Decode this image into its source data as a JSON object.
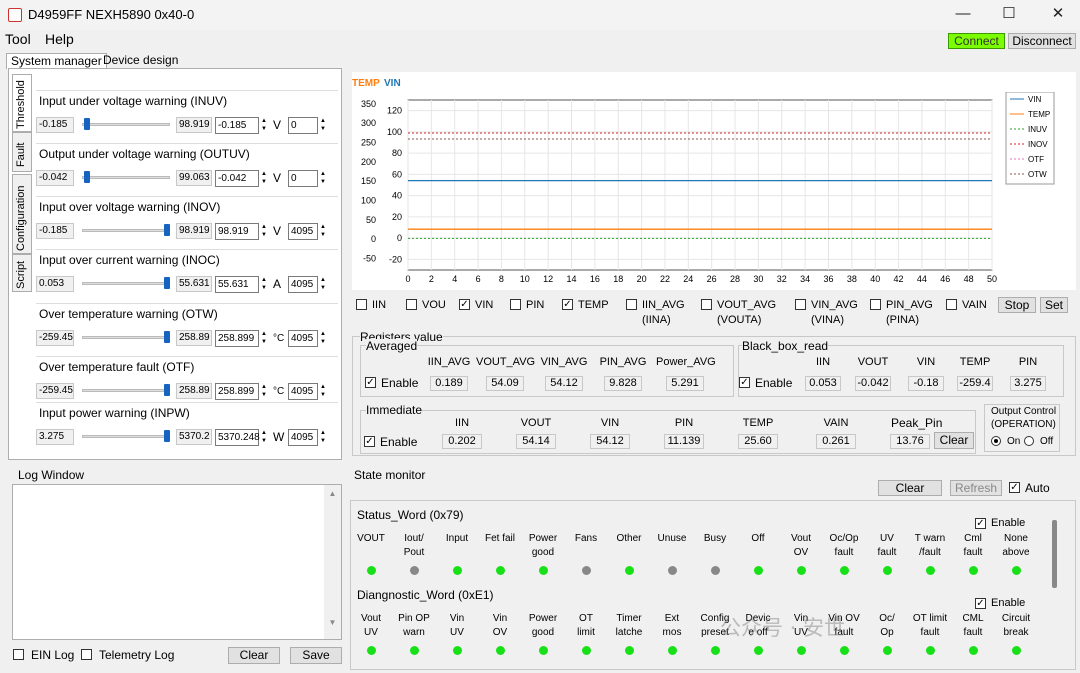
{
  "window": {
    "title": "D4959FF NEXH5890 0x40-0",
    "min": "—",
    "max": "☐",
    "close": "✕"
  },
  "menu": {
    "tool": "Tool",
    "help": "Help"
  },
  "toolbar": {
    "connect": "Connect",
    "disconnect": "Disconnect"
  },
  "tabs": {
    "system_manager": "System manager",
    "device_design": "Device design"
  },
  "vtabs": [
    "Threshold",
    "Fault",
    "Configuration",
    "Script"
  ],
  "thresholds": [
    {
      "title": "Input under voltage warning (INUV)",
      "min": "-0.185",
      "max": "98.919",
      "value": "-0.185",
      "unit": "V",
      "raw": "0",
      "level": 0.02
    },
    {
      "title": "Output under voltage warning (OUTUV)",
      "min": "-0.042",
      "max": "99.063",
      "value": "-0.042",
      "unit": "V",
      "raw": "0",
      "level": 0.02
    },
    {
      "title": "Input over voltage warning (INOV)",
      "min": "-0.185",
      "max": "98.919",
      "value": "98.919",
      "unit": "V",
      "raw": "4095",
      "level": 0.98
    },
    {
      "title": "Input over current warning (INOC)",
      "min": "0.053",
      "max": "55.631",
      "value": "55.631",
      "unit": "A",
      "raw": "4095",
      "level": 0.98
    },
    {
      "title": "Over temperature warning (OTW)",
      "min": "-259.45",
      "max": "258.89",
      "value": "258.899",
      "unit": "°C",
      "raw": "4095",
      "level": 0.98
    },
    {
      "title": "Over temperature fault (OTF)",
      "min": "-259.45",
      "max": "258.89",
      "value": "258.899",
      "unit": "°C",
      "raw": "4095",
      "level": 0.98
    },
    {
      "title": "Input power warning (INPW)",
      "min": "3.275",
      "max": "5370.2",
      "value": "5370.248",
      "unit": "W",
      "raw": "4095",
      "level": 0.98
    }
  ],
  "log": {
    "title": "Log Window",
    "ein": "EIN Log",
    "telemetry": "Telemetry Log",
    "clear": "Clear",
    "save": "Save"
  },
  "chart_data": {
    "type": "line",
    "axis_labels": {
      "left": "TEMP",
      "right": "VIN"
    },
    "left_ticks": [
      "350",
      "300",
      "250",
      "200",
      "150",
      "100",
      "50",
      "0",
      "-50"
    ],
    "right_ticks": [
      "120",
      "100",
      "80",
      "60",
      "40",
      "20",
      "0",
      "-20"
    ],
    "x": [
      0,
      50
    ],
    "x_ticks": [
      "0",
      "2",
      "4",
      "6",
      "8",
      "10",
      "12",
      "14",
      "16",
      "18",
      "20",
      "22",
      "24",
      "26",
      "28",
      "30",
      "32",
      "34",
      "36",
      "38",
      "40",
      "42",
      "44",
      "46",
      "48",
      "50"
    ],
    "ylim_right": [
      -30,
      130
    ],
    "series": [
      {
        "name": "VIN",
        "color": "#1f77b4",
        "y": 54.12,
        "style": "solid"
      },
      {
        "name": "TEMP",
        "color": "#ff7f0e",
        "y": 25.6,
        "style": "solid"
      },
      {
        "name": "INUV",
        "color": "#2ca02c",
        "y": -0.185,
        "style": "dotted"
      },
      {
        "name": "INOV",
        "color": "#d62728",
        "y": 98.919,
        "style": "dotted"
      },
      {
        "name": "OTF",
        "color": "#e377c2",
        "y": 258.899,
        "style": "dotted"
      },
      {
        "name": "OTW",
        "color": "#8c564b",
        "y": 258.899,
        "style": "dotted"
      }
    ],
    "legend": "top-right"
  },
  "chart_checks": [
    {
      "label": "IIN",
      "checked": false
    },
    {
      "label": "VOU",
      "checked": false
    },
    {
      "label": "VIN",
      "checked": true
    },
    {
      "label": "PIN",
      "checked": false
    },
    {
      "label": "TEMP",
      "checked": true
    },
    {
      "label": "IIN_AVG\n(IINA)",
      "checked": false
    },
    {
      "label": "VOUT_AVG\n(VOUTA)",
      "checked": false
    },
    {
      "label": "VIN_AVG\n(VINA)",
      "checked": false
    },
    {
      "label": "PIN_AVG\n(PINA)",
      "checked": false
    },
    {
      "label": "VAIN",
      "checked": false
    }
  ],
  "chart_buttons": {
    "stop": "Stop",
    "set": "Set"
  },
  "registers": {
    "title": "Registers value",
    "averaged": {
      "title": "Averaged",
      "enable": "Enable",
      "headers": [
        "IIN_AVG",
        "VOUT_AVG",
        "VIN_AVG",
        "PIN_AVG",
        "Power_AVG"
      ],
      "values": [
        "0.189",
        "54.09",
        "54.12",
        "9.828",
        "5.291"
      ]
    },
    "blackbox": {
      "title": "Black_box_read",
      "enable": "Enable",
      "headers": [
        "IIN",
        "VOUT",
        "VIN",
        "TEMP",
        "PIN"
      ],
      "values": [
        "0.053",
        "-0.042",
        "-0.18",
        "-259.4",
        "3.275"
      ]
    },
    "immediate": {
      "title": "Immediate",
      "enable": "Enable",
      "headers": [
        "IIN",
        "VOUT",
        "VIN",
        "PIN",
        "TEMP",
        "VAIN"
      ],
      "values": [
        "0.202",
        "54.14",
        "54.12",
        "11.139",
        "25.60",
        "0.261"
      ]
    },
    "peak": {
      "title": "Peak_Pin",
      "value": "13.76",
      "clear": "Clear"
    },
    "output": {
      "title": "Output Control\n(OPERATION)",
      "on": "On",
      "off": "Off"
    }
  },
  "state": {
    "title": "State monitor",
    "clear": "Clear",
    "refresh": "Refresh",
    "auto": "Auto",
    "status": {
      "title": "Status_Word (0x79)",
      "enable": "Enable",
      "items": [
        {
          "l": "VOUT",
          "c": "g"
        },
        {
          "l": "Iout/\nPout",
          "c": "x"
        },
        {
          "l": "Input",
          "c": "g"
        },
        {
          "l": "Fet fail",
          "c": "g"
        },
        {
          "l": "Power\ngood",
          "c": "g"
        },
        {
          "l": "Fans",
          "c": "x"
        },
        {
          "l": "Other",
          "c": "g"
        },
        {
          "l": "Unuse",
          "c": "x"
        },
        {
          "l": "Busy",
          "c": "x"
        },
        {
          "l": "Off",
          "c": "g"
        },
        {
          "l": "Vout\nOV",
          "c": "g"
        },
        {
          "l": "Oc/Op\nfault",
          "c": "g"
        },
        {
          "l": "UV\nfault",
          "c": "g"
        },
        {
          "l": "T warn\n/fault",
          "c": "g"
        },
        {
          "l": "Cml\nfault",
          "c": "g"
        },
        {
          "l": "None\nabove",
          "c": "g"
        }
      ]
    },
    "diag": {
      "title": "Diangnostic_Word (0xE1)",
      "enable": "Enable",
      "items": [
        {
          "l": "Vout\nUV",
          "c": "g"
        },
        {
          "l": "Pin OP\nwarn",
          "c": "g"
        },
        {
          "l": "Vin\nUV",
          "c": "g"
        },
        {
          "l": "Vin\nOV",
          "c": "g"
        },
        {
          "l": "Power\ngood",
          "c": "g"
        },
        {
          "l": "OT\nlimit",
          "c": "g"
        },
        {
          "l": "Timer\nlatche",
          "c": "g"
        },
        {
          "l": "Ext\nmos",
          "c": "g"
        },
        {
          "l": "Config\npreset",
          "c": "g"
        },
        {
          "l": "Devic\ne off",
          "c": "g"
        },
        {
          "l": "Vin\nUV",
          "c": "g"
        },
        {
          "l": "Vin OV\nfault",
          "c": "g"
        },
        {
          "l": "Oc/\nOp",
          "c": "g"
        },
        {
          "l": "OT limit\nfault",
          "c": "g"
        },
        {
          "l": "CML\nfault",
          "c": "g"
        },
        {
          "l": "Circuit\nbreak",
          "c": "g"
        }
      ]
    }
  },
  "watermark": "公众号 · 安世"
}
